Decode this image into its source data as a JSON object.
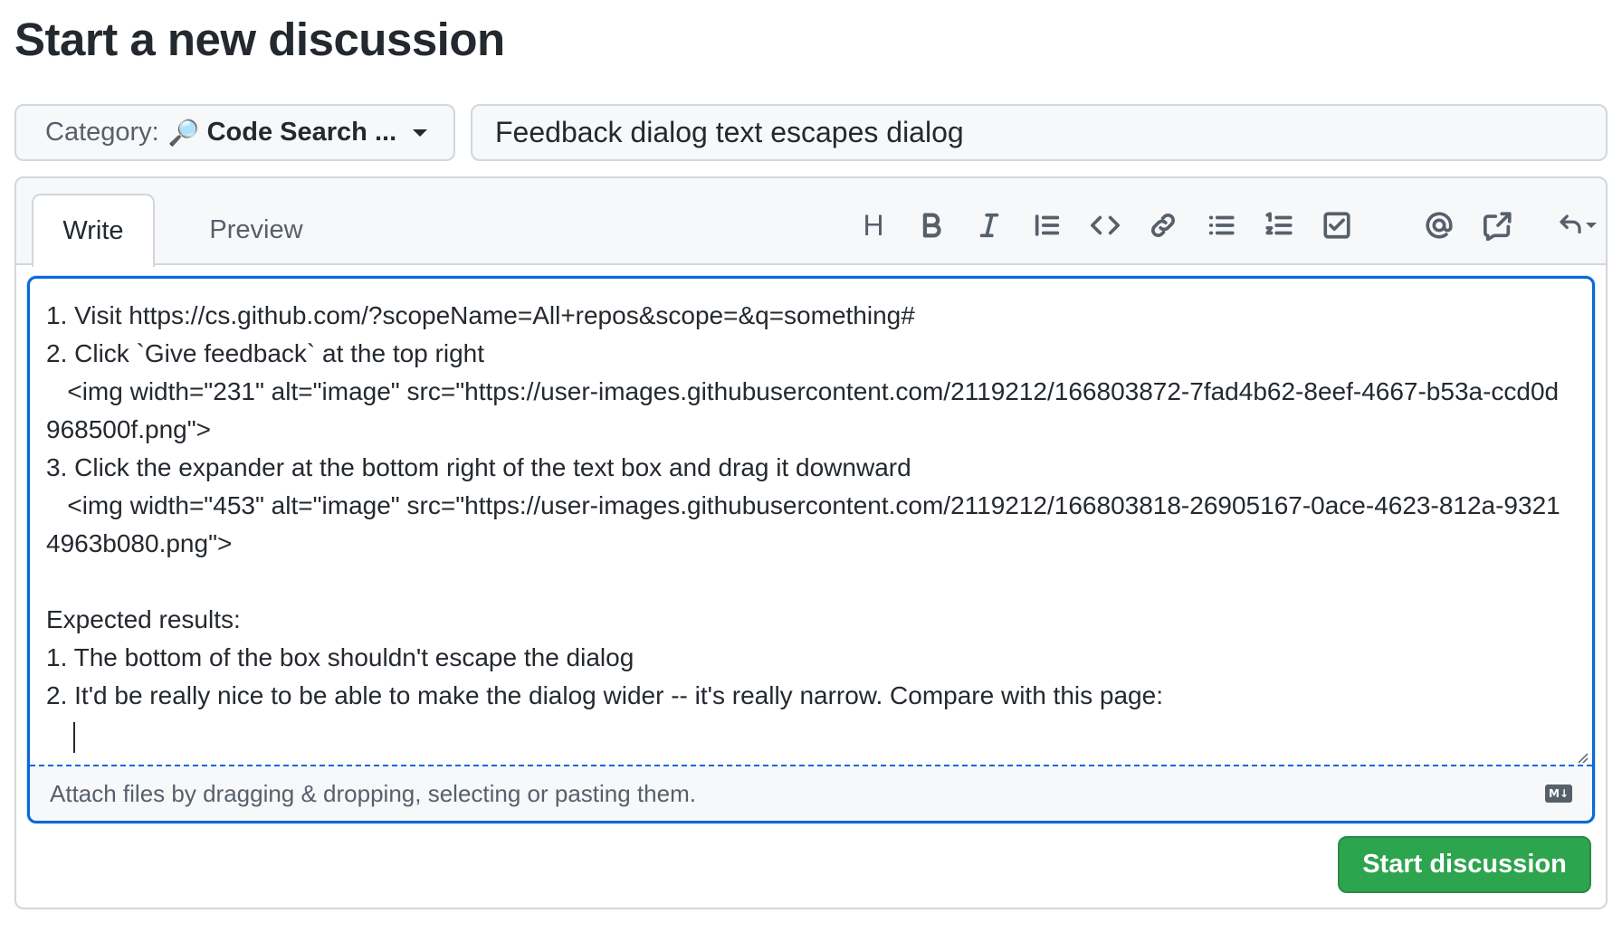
{
  "page": {
    "title": "Start a new discussion"
  },
  "category": {
    "label": "Category:",
    "emoji": "🔎",
    "value": "Code Search ..."
  },
  "title_input": {
    "value": "Feedback dialog text escapes dialog"
  },
  "tabs": [
    {
      "label": "Write",
      "active": true
    },
    {
      "label": "Preview",
      "active": false
    }
  ],
  "toolbar": {
    "icons": [
      "heading-icon",
      "bold-icon",
      "italic-icon",
      "quote-icon",
      "code-icon",
      "link-icon",
      "bulleted-list-icon",
      "numbered-list-icon",
      "task-list-icon",
      "mention-icon",
      "cross-reference-icon",
      "reply-icon"
    ],
    "heading_glyph": "H"
  },
  "editor": {
    "body": "1. Visit https://cs.github.com/?scopeName=All+repos&scope=&q=something#\n2. Click `Give feedback` at the top right\n   <img width=\"231\" alt=\"image\" src=\"https://user-images.githubusercontent.com/2119212/166803872-7fad4b62-8eef-4667-b53a-ccd0d968500f.png\">\n3. Click the expander at the bottom right of the text box and drag it downward\n   <img width=\"453\" alt=\"image\" src=\"https://user-images.githubusercontent.com/2119212/166803818-26905167-0ace-4623-812a-93214963b080.png\">\n\nExpected results:\n1. The bottom of the box shouldn't escape the dialog\n2. It'd be really nice to be able to make the dialog wider -- it's really narrow. Compare with this page:\n   ",
    "attach_hint": "Attach files by dragging & dropping, selecting or pasting them.",
    "markdown_badge": "M↓"
  },
  "actions": {
    "submit_label": "Start discussion"
  },
  "colors": {
    "accent": "#0969da",
    "submit": "#2da44e",
    "border": "#d0d7de",
    "muted_text": "#57606a"
  }
}
